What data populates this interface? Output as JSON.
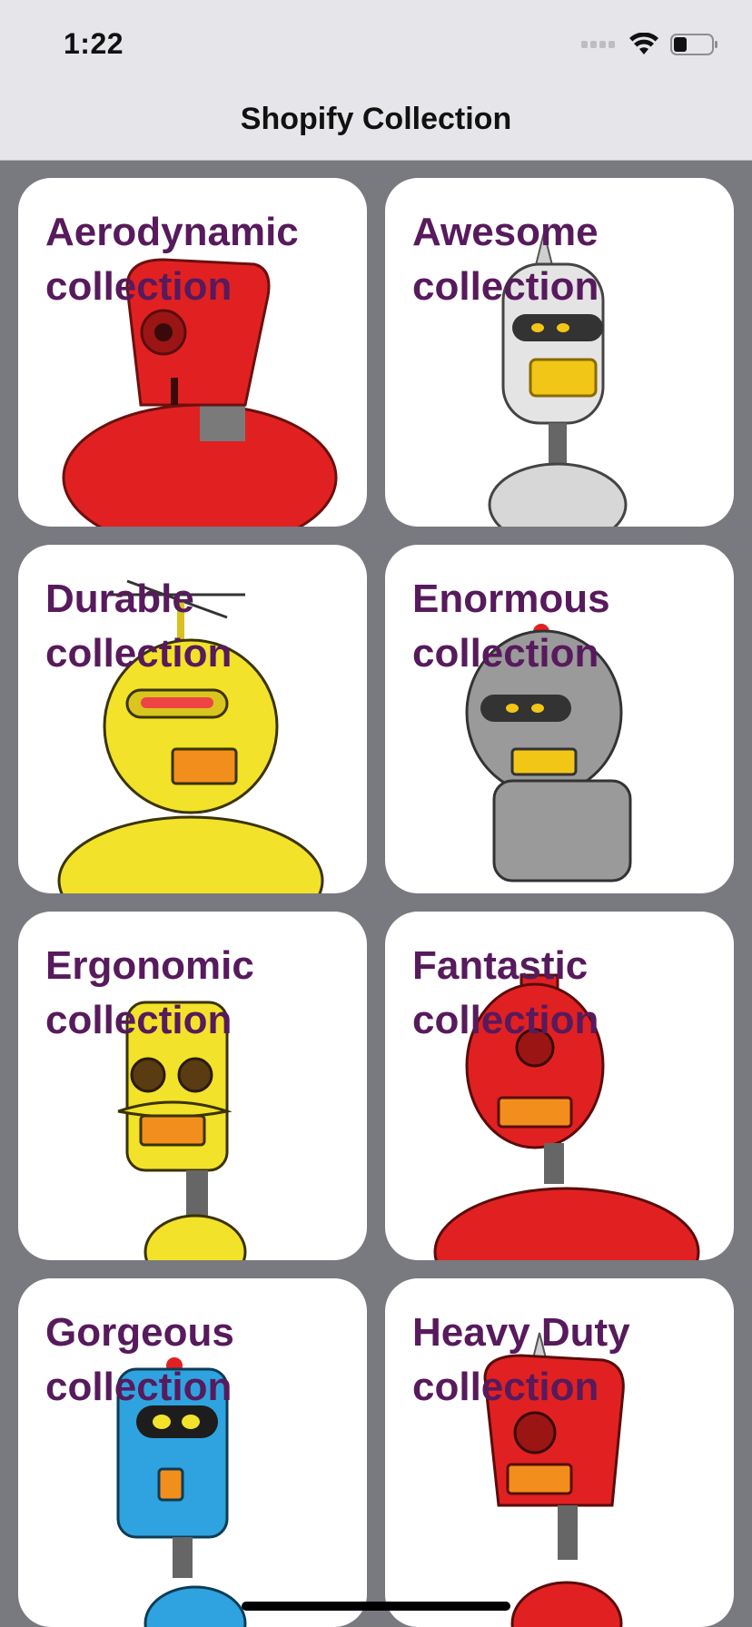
{
  "status_bar": {
    "time": "1:22"
  },
  "nav": {
    "title": "Shopify Collection"
  },
  "collections": [
    {
      "name": "Aerodynamic",
      "suffix": "collection",
      "robot_color": "#e12121"
    },
    {
      "name": "Awesome",
      "suffix": "collection",
      "robot_color": "#d9d9d9"
    },
    {
      "name": "Durable",
      "suffix": "collection",
      "robot_color": "#f2e22a"
    },
    {
      "name": "Enormous",
      "suffix": "collection",
      "robot_color": "#8f8f8f"
    },
    {
      "name": "Ergonomic",
      "suffix": "collection",
      "robot_color": "#f2e22a"
    },
    {
      "name": "Fantastic",
      "suffix": "collection",
      "robot_color": "#e12121"
    },
    {
      "name": "Gorgeous",
      "suffix": "collection",
      "robot_color": "#2ea3df"
    },
    {
      "name": "Heavy Duty",
      "suffix": "collection",
      "robot_color": "#e12121"
    }
  ],
  "colors": {
    "background": "#797980",
    "card": "#ffffff",
    "title_text": "#571a5c",
    "nav_bar": "#e5e5ea"
  }
}
